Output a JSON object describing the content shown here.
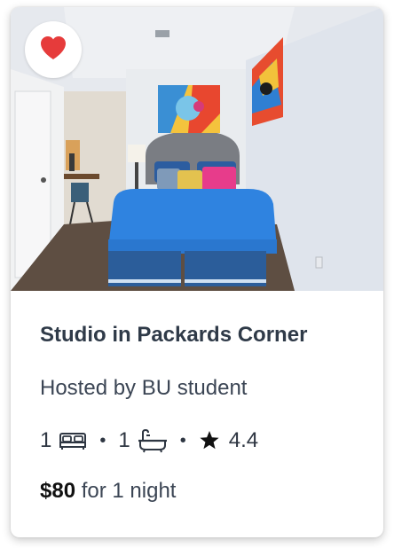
{
  "listing": {
    "title": "Studio in Packards Corner",
    "host": "Hosted by BU student",
    "beds": "1",
    "baths": "1",
    "rating": "4.4",
    "price": "$80",
    "price_suffix": "for 1 night",
    "favorited": true,
    "photo_alt": "Studio apartment bedroom with blue bed and colorful pop-art paintings"
  },
  "icons": {
    "favorite": "heart-icon",
    "bed": "bed-icon",
    "bath": "bathtub-icon",
    "rating": "star-icon"
  },
  "colors": {
    "heart": "#e63b3b",
    "title": "#2f3a48",
    "text": "#3b4554"
  }
}
